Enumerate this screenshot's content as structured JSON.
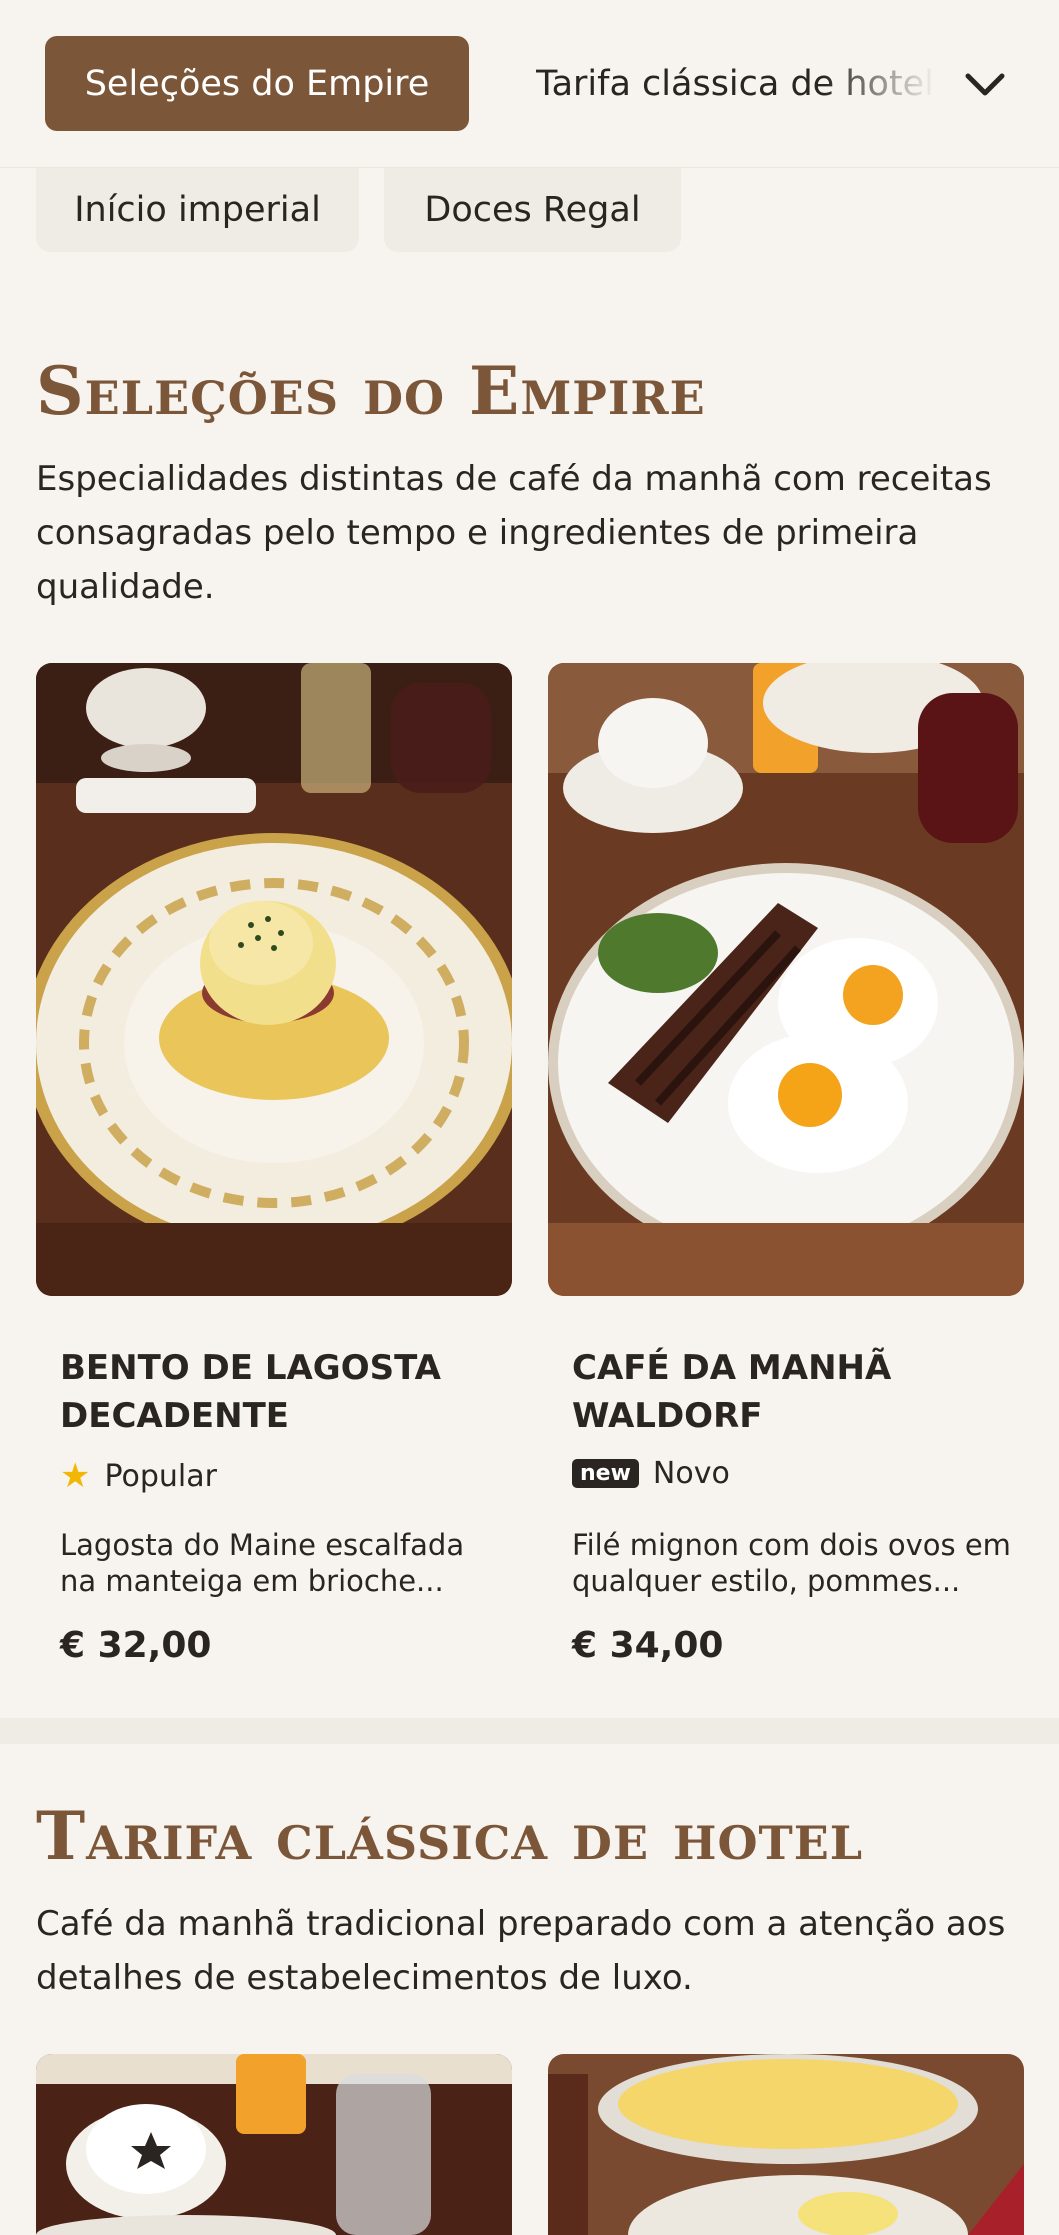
{
  "nav": {
    "active_tab": "Seleções do Empire",
    "next_tab": "Tarifa clássica de hotel",
    "expand_icon": "chevron-down-icon"
  },
  "chips": [
    {
      "label": "Início imperial"
    },
    {
      "label": "Doces Regal"
    }
  ],
  "sections": [
    {
      "title": "Seleções do Empire",
      "description": "Especialidades distintas de café da manhã com receitas consagradas pelo tempo e ingredientes de primeira qualidade.",
      "items": [
        {
          "name": "Bento de Lagosta Decadente",
          "tag_icon": "star-icon",
          "tag": "Popular",
          "description": "Lagosta do Maine escalfada na manteiga em brioche...",
          "price": "€ 32,00"
        },
        {
          "name": "Café da manhã Waldorf",
          "tag_badge": "new",
          "tag": "Novo",
          "description": "Filé mignon com dois ovos em qualquer estilo, pommes...",
          "price": "€ 34,00"
        }
      ]
    },
    {
      "title": "Tarifa clássica de hotel",
      "description": "Café da manhã tradicional preparado com a atenção aos detalhes de estabelecimentos de luxo."
    }
  ],
  "colors": {
    "accent": "#7c5638",
    "background": "#f7f4ef",
    "text": "#2b2521",
    "star": "#f2b705"
  }
}
